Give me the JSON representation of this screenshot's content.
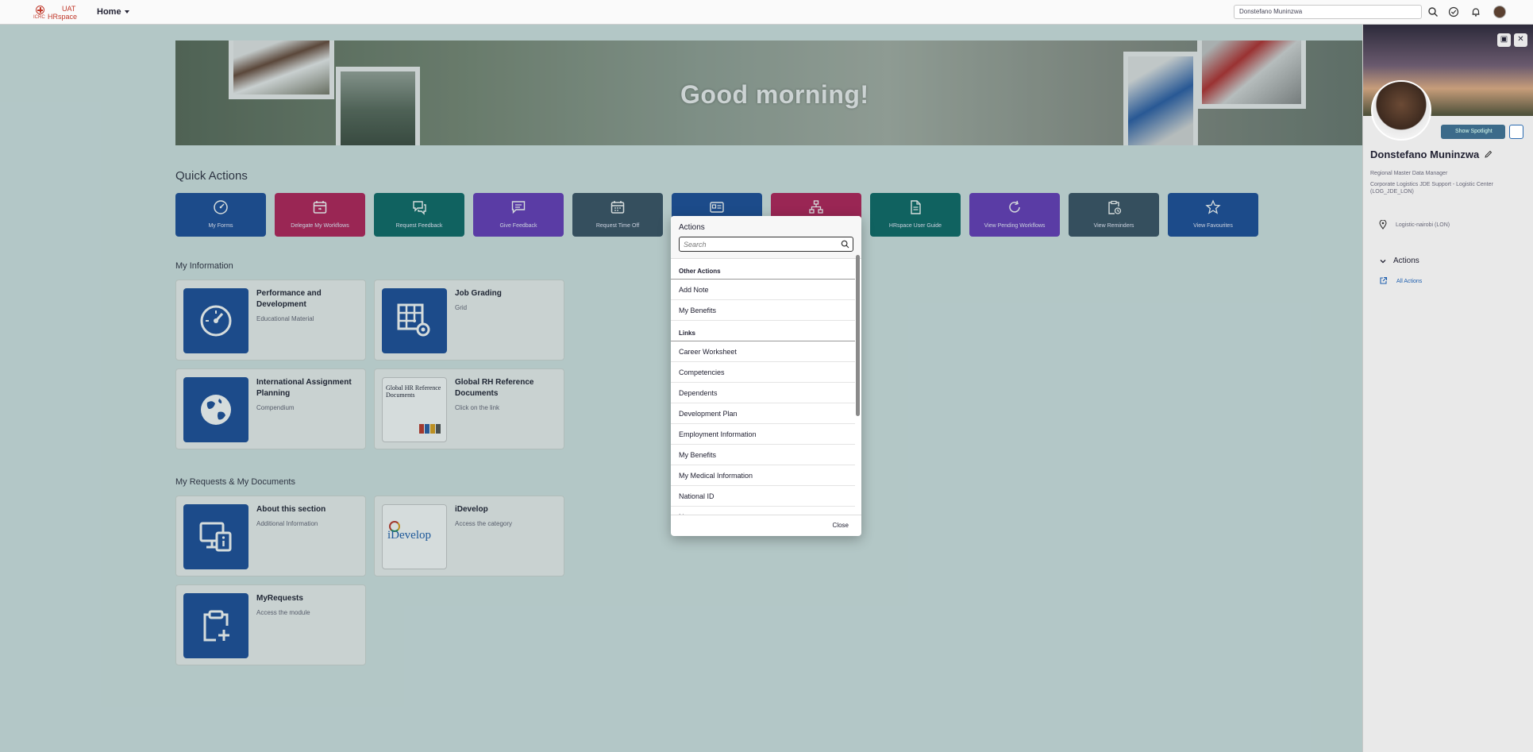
{
  "header": {
    "logo": {
      "brand": "UAT",
      "product": "HRspace",
      "org": "ICRC"
    },
    "nav_label": "Home",
    "search_value": "Donstefano Muninzwa",
    "icons": [
      "search-icon",
      "check-circle-icon",
      "bell-icon",
      "avatar"
    ]
  },
  "banner": {
    "greeting": "Good morning!"
  },
  "quick_actions": {
    "title": "Quick Actions",
    "tiles": [
      {
        "label": "My Forms",
        "icon": "gauge-icon",
        "color": "#1e4f9c"
      },
      {
        "label": "Delegate My Workflows",
        "icon": "calendar-icon",
        "color": "#b8215a"
      },
      {
        "label": "Request Feedback",
        "icon": "chat-bubbles-icon",
        "color": "#0f6b68"
      },
      {
        "label": "Give Feedback",
        "icon": "comment-icon",
        "color": "#6a3cbc"
      },
      {
        "label": "Request Time Off",
        "icon": "calendar-grid-icon",
        "color": "#3c5366"
      },
      {
        "label": "",
        "icon": "id-card-icon",
        "color": "#1e4f9c"
      },
      {
        "label": "",
        "icon": "org-chart-icon",
        "color": "#b8215a"
      },
      {
        "label": "HRspace User Guide",
        "icon": "document-icon",
        "color": "#0f6b68"
      },
      {
        "label": "View Pending Workflows",
        "icon": "refresh-icon",
        "color": "#6a3cbc"
      },
      {
        "label": "View Reminders",
        "icon": "clipboard-clock-icon",
        "color": "#3c5366"
      },
      {
        "label": "View Favourites",
        "icon": "star-icon",
        "color": "#1e4f9c"
      }
    ]
  },
  "my_information": {
    "title": "My Information",
    "cards": [
      {
        "title": "Performance and Development",
        "desc": "Educational Material"
      },
      {
        "title": "Job Grading",
        "desc": "Grid"
      },
      {
        "title": "International Assignment Planning",
        "desc": "Compendium"
      },
      {
        "title": "Global RH Reference Documents",
        "desc": "Click on the link",
        "thumb": "Global HR Reference Documents"
      }
    ]
  },
  "my_requests": {
    "title": "My Requests & My Documents",
    "cards": [
      {
        "title": "About this section",
        "desc": "Additional Information"
      },
      {
        "title": "iDevelop",
        "desc": "Access the category",
        "thumb": "iDevelop"
      },
      {
        "title": "MyRequests",
        "desc": "Access the module"
      }
    ]
  },
  "dialog": {
    "title": "Actions",
    "search_placeholder": "Search",
    "groups": [
      {
        "label": "Other Actions",
        "items": [
          "Add Note",
          "My Benefits"
        ]
      },
      {
        "label": "Links",
        "items": [
          "Career Worksheet",
          "Competencies",
          "Dependents",
          "Development Plan",
          "Employment Information",
          "My Benefits",
          "My Medical Information",
          "National ID",
          "Notes"
        ]
      }
    ],
    "close_label": "Close"
  },
  "profile": {
    "spotlight_label": "Show Spotlight",
    "name": "Donstefano Muninzwa",
    "role": "Regional Master Data Manager",
    "department": "Corporate Logistics JDE Support - Logistic Center (LOG_JDE_LON)",
    "location": "Logistic-nairobi (LON)",
    "actions_header": "Actions",
    "all_actions_link": "All Actions"
  }
}
